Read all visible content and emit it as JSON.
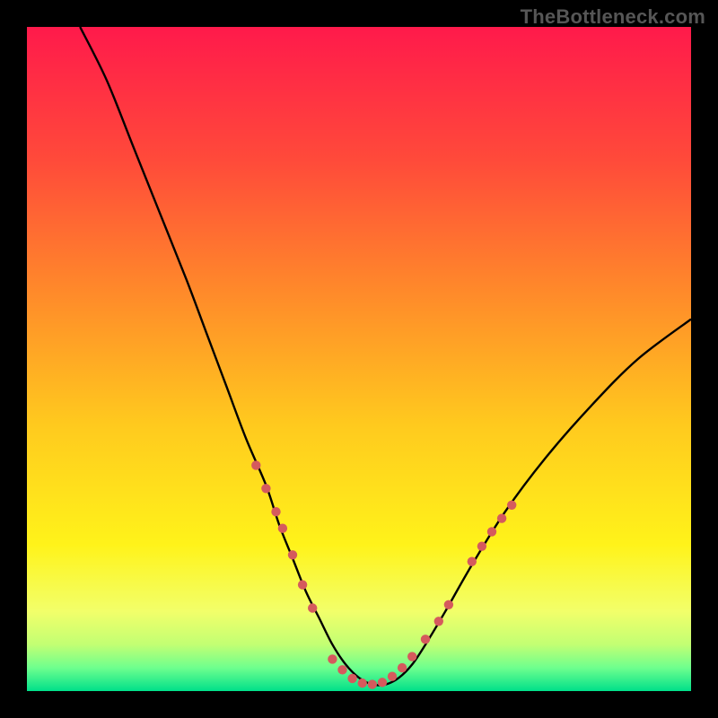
{
  "watermark": "TheBottleneck.com",
  "chart_data": {
    "type": "line",
    "title": "",
    "xlabel": "",
    "ylabel": "",
    "xlim": [
      0,
      100
    ],
    "ylim": [
      0,
      100
    ],
    "grid": false,
    "legend": false,
    "background_gradient_stops": [
      {
        "offset": 0.0,
        "color": "#ff1a4b"
      },
      {
        "offset": 0.2,
        "color": "#ff4a3a"
      },
      {
        "offset": 0.4,
        "color": "#ff8a2a"
      },
      {
        "offset": 0.6,
        "color": "#ffca1e"
      },
      {
        "offset": 0.78,
        "color": "#fff31a"
      },
      {
        "offset": 0.88,
        "color": "#f2ff6a"
      },
      {
        "offset": 0.93,
        "color": "#c2ff73"
      },
      {
        "offset": 0.965,
        "color": "#6eff8e"
      },
      {
        "offset": 1.0,
        "color": "#00e08a"
      }
    ],
    "series": [
      {
        "name": "bottleneck-curve",
        "color": "#000000",
        "x": [
          8,
          12,
          16,
          20,
          24,
          27,
          30,
          33,
          36,
          38,
          40,
          42,
          44,
          46,
          48,
          50,
          52,
          54,
          56,
          58,
          60,
          63,
          67,
          72,
          78,
          85,
          92,
          100
        ],
        "y": [
          100,
          92,
          82,
          72,
          62,
          54,
          46,
          38,
          31,
          25,
          20,
          15,
          11,
          7,
          4,
          2,
          1,
          1,
          2,
          4,
          7,
          12,
          19,
          27,
          35,
          43,
          50,
          56
        ]
      }
    ],
    "marker_groups": [
      {
        "name": "left-cluster",
        "color": "#d55a5d",
        "radius": 5.2,
        "points": [
          [
            34.5,
            34.0
          ],
          [
            36.0,
            30.5
          ],
          [
            37.5,
            27.0
          ],
          [
            38.5,
            24.5
          ],
          [
            40.0,
            20.5
          ],
          [
            41.5,
            16.0
          ],
          [
            43.0,
            12.5
          ]
        ]
      },
      {
        "name": "bottom-cluster",
        "color": "#d55a5d",
        "radius": 5.2,
        "points": [
          [
            46.0,
            4.8
          ],
          [
            47.5,
            3.2
          ],
          [
            49.0,
            1.9
          ],
          [
            50.5,
            1.2
          ],
          [
            52.0,
            1.0
          ],
          [
            53.5,
            1.3
          ],
          [
            55.0,
            2.2
          ],
          [
            56.5,
            3.5
          ],
          [
            58.0,
            5.2
          ]
        ]
      },
      {
        "name": "right-small-cluster",
        "color": "#d55a5d",
        "radius": 5.2,
        "points": [
          [
            60.0,
            7.8
          ],
          [
            62.0,
            10.5
          ],
          [
            63.5,
            13.0
          ]
        ]
      },
      {
        "name": "right-upper-cluster",
        "color": "#d55a5d",
        "radius": 5.2,
        "points": [
          [
            67.0,
            19.5
          ],
          [
            68.5,
            21.8
          ],
          [
            70.0,
            24.0
          ],
          [
            71.5,
            26.0
          ],
          [
            73.0,
            28.0
          ]
        ]
      }
    ]
  }
}
